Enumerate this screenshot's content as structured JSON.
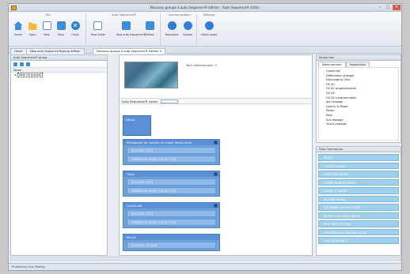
{
  "window": {
    "title": "Nouveau groupe à auto Sequence® édition - Auto Sequence® Editor",
    "minimize": "–",
    "maximize": "□",
    "close": "✕"
  },
  "ribbon": {
    "groups": [
      {
        "title": "File",
        "buttons": [
          {
            "label": "Home",
            "icon": "home-icon"
          },
          {
            "label": "Open",
            "icon": "folder-icon"
          },
          {
            "label": "New",
            "icon": "new-document-icon"
          },
          {
            "label": "Save",
            "icon": "save-icon"
          },
          {
            "label": "Close",
            "icon": "close-circle-icon"
          }
        ]
      },
      {
        "title": "Auto Sequence®",
        "buttons": [
          {
            "label": "New folder",
            "icon": "new-folder-icon"
          },
          {
            "label": "New auto Sequence®",
            "icon": "new-sequence-icon"
          },
          {
            "label": "Delete",
            "icon": "delete-icon"
          }
        ]
      },
      {
        "title": "Communication",
        "buttons": [
          {
            "label": "Download",
            "icon": "download-icon"
          },
          {
            "label": "Upload",
            "icon": "upload-icon"
          }
        ]
      },
      {
        "title": "Settings",
        "buttons": [
          {
            "label": "Hatch angle",
            "icon": "hatch-angle-icon"
          }
        ]
      }
    ]
  },
  "tabs": [
    {
      "label": "Home"
    },
    {
      "label": "New auto Sequence®group édition"
    },
    {
      "label": "Nouveau groupe à auto Sequence® édition ✕"
    }
  ],
  "left_panel": {
    "title": "Auto Sequence® group",
    "column_name": "Name",
    "tree_item": "Nom du groupe"
  },
  "center": {
    "thumbnail_label": "Tech sélectionnée: 3",
    "sequence_name_label": "Auto Sequence® name:",
    "start_label": "Début",
    "blocks": [
      {
        "title": "Résistance de contact en mode découverte",
        "rows": [
          "RESULTAT TEST",
          "OPERATION APRÈS FIN DU TEST"
        ]
      },
      {
        "title": "Trace",
        "rows": [
          "RESULTAT TEST",
          "OPERATION APRÈS FIN DU TEST"
        ]
      },
      {
        "title": "Continuité",
        "rows": [
          "RESULTAT TEST",
          "OPERATION APRÈS FIN DU TEST"
        ]
      },
      {
        "title": "Result",
        "rows": [
          "RESULTAT GLOBAL"
        ]
      }
    ]
  },
  "right_panel": {
    "single_test_title": "Single test",
    "subtabs": [
      "Measurement",
      "Inspections"
    ],
    "measurements": [
      "Continuity",
      "Differential Leakage",
      "Discharging Time",
      "HV AC",
      "HV AC programmable",
      "HV DC",
      "HV DC programmable",
      "Ipe Leakage",
      "Leak'Ip & Power",
      "Power",
      "Pass",
      "Sub leakage",
      "Touch Leakage"
    ],
    "flow_commands_title": "Flow Commands",
    "flow_commands": [
      "PAUSE",
      "OUTPUT MODE",
      "EXPECTED MODE",
      "LAMPE MARCHE MODE",
      "LAMPE ST MODE",
      "BUZZER MODE",
      "EXTERNAL OUTPUT MODE",
      "RESULT FOR AUTO MODE",
      "PLAY PROTECTION",
      "OPERATION AFTER END MODE",
      "CALL SEQUENCE"
    ]
  },
  "statusbar": {
    "text": "Production Line Testing"
  }
}
